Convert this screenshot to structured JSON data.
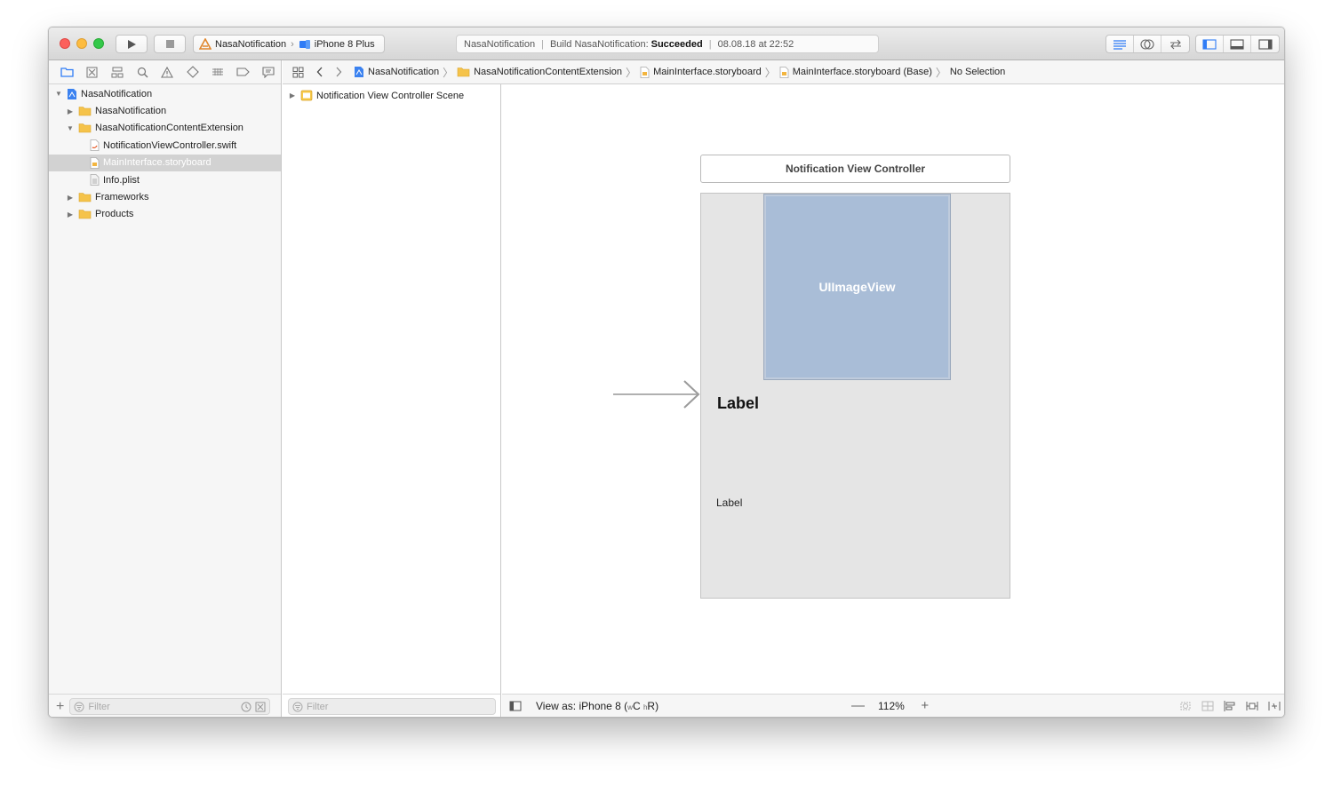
{
  "titlebar": {
    "scheme": {
      "target": "NasaNotification",
      "device": "iPhone 8 Plus"
    },
    "activity": {
      "project": "NasaNotification",
      "build_prefix": "Build NasaNotification:",
      "build_status": "Succeeded",
      "timestamp": "08.08.18 at 22:52"
    }
  },
  "navigator": {
    "tree": [
      {
        "label": "NasaNotification",
        "icon": "project-icon",
        "expanded": true,
        "depth": 0
      },
      {
        "label": "NasaNotification",
        "icon": "folder-icon",
        "expanded": false,
        "depth": 1
      },
      {
        "label": "NasaNotificationContentExtension",
        "icon": "folder-icon",
        "expanded": true,
        "depth": 1
      },
      {
        "label": "NotificationViewController.swift",
        "icon": "swift-file-icon",
        "depth": 2
      },
      {
        "label": "MainInterface.storyboard",
        "icon": "storyboard-file-icon",
        "depth": 2,
        "selected": true
      },
      {
        "label": "Info.plist",
        "icon": "plist-file-icon",
        "depth": 2
      },
      {
        "label": "Frameworks",
        "icon": "folder-icon",
        "expanded": false,
        "depth": 1
      },
      {
        "label": "Products",
        "icon": "folder-icon",
        "expanded": false,
        "depth": 1
      }
    ],
    "filter_placeholder": "Filter"
  },
  "jumpbar": {
    "crumbs": [
      "NasaNotification",
      "NasaNotificationContentExtension",
      "MainInterface.storyboard",
      "MainInterface.storyboard (Base)",
      "No Selection"
    ]
  },
  "outline": {
    "scene": "Notification View Controller Scene",
    "filter_placeholder": "Filter"
  },
  "canvas": {
    "vc_title": "Notification View Controller",
    "image_view": "UIImageView",
    "label_large": "Label",
    "label_small": "Label"
  },
  "canvas_bottom": {
    "view_as": "View as: iPhone 8 (",
    "w_class": "w",
    "w_size": "C ",
    "h_class": "h",
    "h_size": "R)",
    "zoom": "112%"
  },
  "colors": {
    "image_view_fill": "#a9bdd7",
    "scene_background": "#e5e5e5",
    "folder": "#f5c34a",
    "accent_blue": "#2f7cf6"
  }
}
